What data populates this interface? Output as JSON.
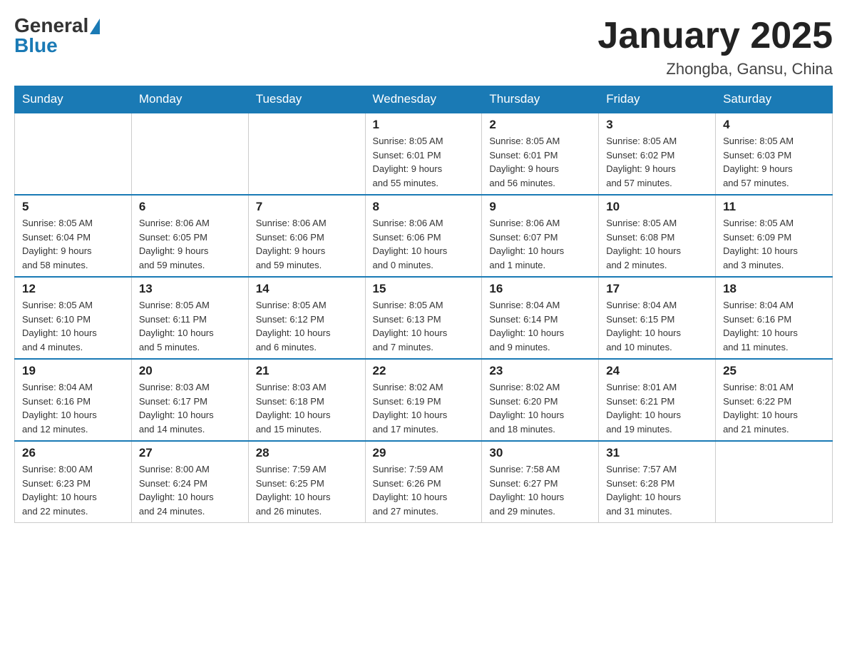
{
  "header": {
    "logo_general": "General",
    "logo_blue": "Blue",
    "title": "January 2025",
    "subtitle": "Zhongba, Gansu, China"
  },
  "weekdays": [
    "Sunday",
    "Monday",
    "Tuesday",
    "Wednesday",
    "Thursday",
    "Friday",
    "Saturday"
  ],
  "weeks": [
    [
      {
        "day": "",
        "info": ""
      },
      {
        "day": "",
        "info": ""
      },
      {
        "day": "",
        "info": ""
      },
      {
        "day": "1",
        "info": "Sunrise: 8:05 AM\nSunset: 6:01 PM\nDaylight: 9 hours\nand 55 minutes."
      },
      {
        "day": "2",
        "info": "Sunrise: 8:05 AM\nSunset: 6:01 PM\nDaylight: 9 hours\nand 56 minutes."
      },
      {
        "day": "3",
        "info": "Sunrise: 8:05 AM\nSunset: 6:02 PM\nDaylight: 9 hours\nand 57 minutes."
      },
      {
        "day": "4",
        "info": "Sunrise: 8:05 AM\nSunset: 6:03 PM\nDaylight: 9 hours\nand 57 minutes."
      }
    ],
    [
      {
        "day": "5",
        "info": "Sunrise: 8:05 AM\nSunset: 6:04 PM\nDaylight: 9 hours\nand 58 minutes."
      },
      {
        "day": "6",
        "info": "Sunrise: 8:06 AM\nSunset: 6:05 PM\nDaylight: 9 hours\nand 59 minutes."
      },
      {
        "day": "7",
        "info": "Sunrise: 8:06 AM\nSunset: 6:06 PM\nDaylight: 9 hours\nand 59 minutes."
      },
      {
        "day": "8",
        "info": "Sunrise: 8:06 AM\nSunset: 6:06 PM\nDaylight: 10 hours\nand 0 minutes."
      },
      {
        "day": "9",
        "info": "Sunrise: 8:06 AM\nSunset: 6:07 PM\nDaylight: 10 hours\nand 1 minute."
      },
      {
        "day": "10",
        "info": "Sunrise: 8:05 AM\nSunset: 6:08 PM\nDaylight: 10 hours\nand 2 minutes."
      },
      {
        "day": "11",
        "info": "Sunrise: 8:05 AM\nSunset: 6:09 PM\nDaylight: 10 hours\nand 3 minutes."
      }
    ],
    [
      {
        "day": "12",
        "info": "Sunrise: 8:05 AM\nSunset: 6:10 PM\nDaylight: 10 hours\nand 4 minutes."
      },
      {
        "day": "13",
        "info": "Sunrise: 8:05 AM\nSunset: 6:11 PM\nDaylight: 10 hours\nand 5 minutes."
      },
      {
        "day": "14",
        "info": "Sunrise: 8:05 AM\nSunset: 6:12 PM\nDaylight: 10 hours\nand 6 minutes."
      },
      {
        "day": "15",
        "info": "Sunrise: 8:05 AM\nSunset: 6:13 PM\nDaylight: 10 hours\nand 7 minutes."
      },
      {
        "day": "16",
        "info": "Sunrise: 8:04 AM\nSunset: 6:14 PM\nDaylight: 10 hours\nand 9 minutes."
      },
      {
        "day": "17",
        "info": "Sunrise: 8:04 AM\nSunset: 6:15 PM\nDaylight: 10 hours\nand 10 minutes."
      },
      {
        "day": "18",
        "info": "Sunrise: 8:04 AM\nSunset: 6:16 PM\nDaylight: 10 hours\nand 11 minutes."
      }
    ],
    [
      {
        "day": "19",
        "info": "Sunrise: 8:04 AM\nSunset: 6:16 PM\nDaylight: 10 hours\nand 12 minutes."
      },
      {
        "day": "20",
        "info": "Sunrise: 8:03 AM\nSunset: 6:17 PM\nDaylight: 10 hours\nand 14 minutes."
      },
      {
        "day": "21",
        "info": "Sunrise: 8:03 AM\nSunset: 6:18 PM\nDaylight: 10 hours\nand 15 minutes."
      },
      {
        "day": "22",
        "info": "Sunrise: 8:02 AM\nSunset: 6:19 PM\nDaylight: 10 hours\nand 17 minutes."
      },
      {
        "day": "23",
        "info": "Sunrise: 8:02 AM\nSunset: 6:20 PM\nDaylight: 10 hours\nand 18 minutes."
      },
      {
        "day": "24",
        "info": "Sunrise: 8:01 AM\nSunset: 6:21 PM\nDaylight: 10 hours\nand 19 minutes."
      },
      {
        "day": "25",
        "info": "Sunrise: 8:01 AM\nSunset: 6:22 PM\nDaylight: 10 hours\nand 21 minutes."
      }
    ],
    [
      {
        "day": "26",
        "info": "Sunrise: 8:00 AM\nSunset: 6:23 PM\nDaylight: 10 hours\nand 22 minutes."
      },
      {
        "day": "27",
        "info": "Sunrise: 8:00 AM\nSunset: 6:24 PM\nDaylight: 10 hours\nand 24 minutes."
      },
      {
        "day": "28",
        "info": "Sunrise: 7:59 AM\nSunset: 6:25 PM\nDaylight: 10 hours\nand 26 minutes."
      },
      {
        "day": "29",
        "info": "Sunrise: 7:59 AM\nSunset: 6:26 PM\nDaylight: 10 hours\nand 27 minutes."
      },
      {
        "day": "30",
        "info": "Sunrise: 7:58 AM\nSunset: 6:27 PM\nDaylight: 10 hours\nand 29 minutes."
      },
      {
        "day": "31",
        "info": "Sunrise: 7:57 AM\nSunset: 6:28 PM\nDaylight: 10 hours\nand 31 minutes."
      },
      {
        "day": "",
        "info": ""
      }
    ]
  ]
}
